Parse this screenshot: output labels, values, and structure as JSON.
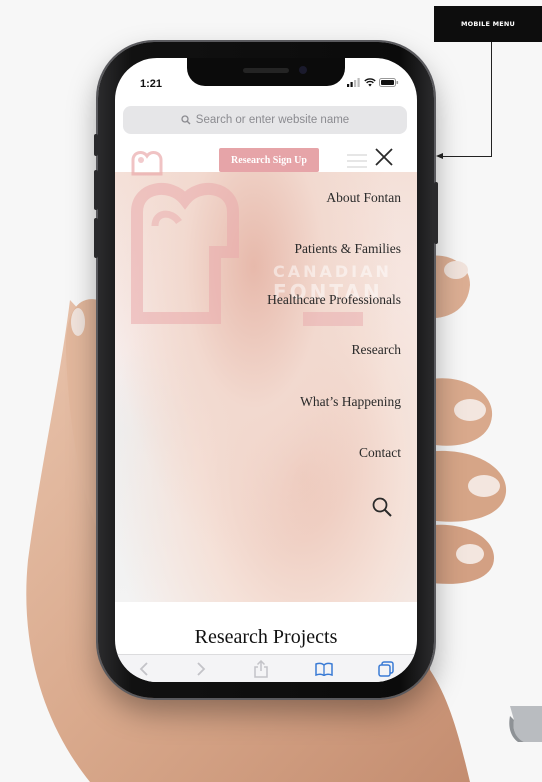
{
  "callout": {
    "label": "MOBILE MENU"
  },
  "status_bar": {
    "time": "1:21"
  },
  "browser": {
    "address_placeholder": "Search or enter website name"
  },
  "site": {
    "signup_label": "Research Sign Up",
    "hero_watermark": [
      "CANADIAN",
      "FONTAN"
    ],
    "menu_items": [
      "About Fontan",
      "Patients & Families",
      "Healthcare Professionals",
      "Research",
      "What’s Happening",
      "Contact"
    ],
    "section_heading": "Research Projects"
  },
  "icons": {
    "close": "close-icon",
    "search": "search-icon",
    "back": "chevron-left-icon",
    "forward": "chevron-right-icon",
    "share": "share-icon",
    "bookmarks": "book-icon",
    "tabs": "tabs-icon"
  },
  "colors": {
    "accent": "#e6a4a8",
    "link_blue": "#3a7bd5",
    "callout_bg": "#0d0d0d"
  }
}
